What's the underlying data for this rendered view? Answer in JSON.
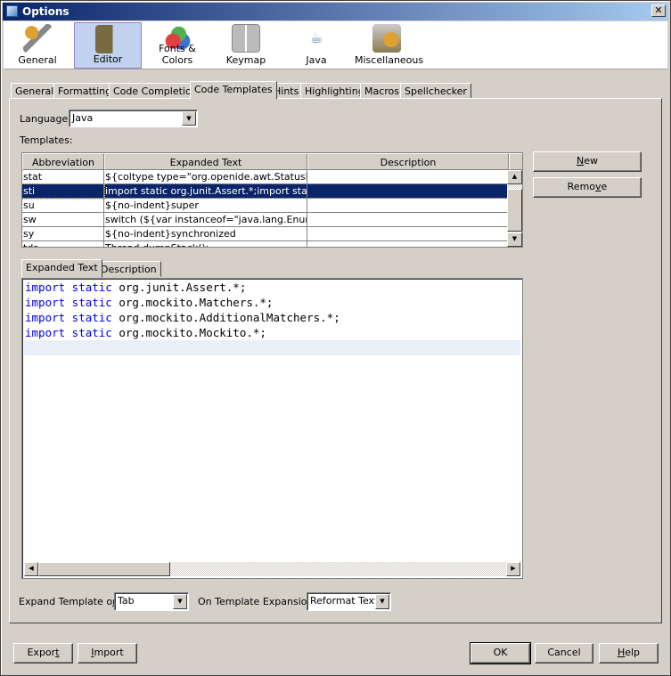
{
  "window": {
    "title": "Options",
    "close_icon": "close-icon"
  },
  "categories": [
    {
      "label": "General",
      "icon": "gear-wrench-icon"
    },
    {
      "label": "Editor",
      "icon": "book-pencil-icon",
      "selected": true
    },
    {
      "label": "Fonts & Colors",
      "icon": "fonts-colors-icon"
    },
    {
      "label": "Keymap",
      "icon": "keyboard-keys-icon"
    },
    {
      "label": "Java",
      "icon": "java-icon"
    },
    {
      "label": "Miscellaneous",
      "icon": "misc-gear-icon"
    }
  ],
  "tabs": [
    "General",
    "Formatting",
    "Code Completion",
    "Code Templates",
    "Hints",
    "Highlighting",
    "Macros",
    "Spellchecker"
  ],
  "selected_tab": "Code Templates",
  "language": {
    "label": "Language:",
    "value": "Java"
  },
  "templates_label": "Templates:",
  "table": {
    "columns": [
      "Abbreviation",
      "Expanded Text",
      "Description"
    ],
    "rows": [
      {
        "abbr": "stat",
        "text": "${coltype type=\"org.openide.awt.StatusDis...",
        "desc": ""
      },
      {
        "abbr": "sti",
        "text": "import static org.junit.Assert.*;import static...",
        "desc": "",
        "selected": true
      },
      {
        "abbr": "su",
        "text": "${no-indent}super",
        "desc": ""
      },
      {
        "abbr": "sw",
        "text": "switch (${var instanceof=\"java.lang.Enum\"...",
        "desc": ""
      },
      {
        "abbr": "sy",
        "text": "${no-indent}synchronized",
        "desc": ""
      },
      {
        "abbr": "tds",
        "text": "Thread.dumpStack();",
        "desc": ""
      }
    ]
  },
  "buttons": {
    "new": "New",
    "remove": "Remove",
    "export": "Export",
    "import": "Import",
    "ok": "OK",
    "cancel": "Cancel",
    "help": "Help"
  },
  "subtabs": [
    "Expanded Text",
    "Description"
  ],
  "editor": {
    "lines": [
      {
        "kw": "import static",
        "rest": " org.junit.Assert.*;"
      },
      {
        "kw": "import static",
        "rest": " org.mockito.Matchers.*;"
      },
      {
        "kw": "import static",
        "rest": " org.mockito.AdditionalMatchers.*;"
      },
      {
        "kw": "import static",
        "rest": " org.mockito.Mockito.*;"
      }
    ]
  },
  "expand_on": {
    "label": "Expand Template on:",
    "value": "Tab"
  },
  "on_expansion": {
    "label": "On Template Expansion:",
    "value": "Reformat Text"
  }
}
